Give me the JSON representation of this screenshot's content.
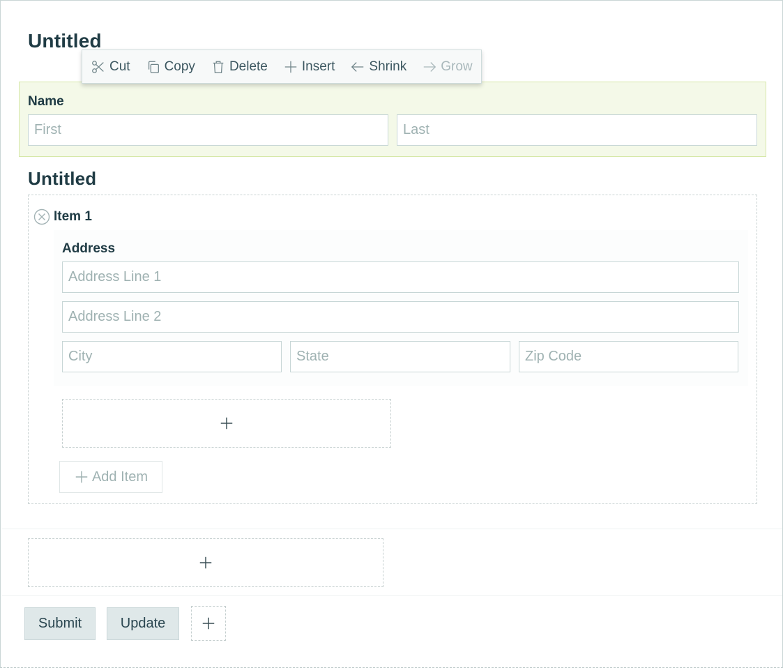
{
  "section1": {
    "title": "Untitled"
  },
  "toolbar": {
    "cut": {
      "label": "Cut",
      "icon": "scissors-icon"
    },
    "copy": {
      "label": "Copy",
      "icon": "copy-icon"
    },
    "delete": {
      "label": "Delete",
      "icon": "trash-icon"
    },
    "insert": {
      "label": "Insert",
      "icon": "plus-icon"
    },
    "shrink": {
      "label": "Shrink",
      "icon": "arrow-left-icon"
    },
    "grow": {
      "label": "Grow",
      "icon": "arrow-right-icon",
      "disabled": true
    }
  },
  "name_field": {
    "label": "Name",
    "first_placeholder": "First",
    "last_placeholder": "Last",
    "highlight_color": "#f4f9e8"
  },
  "section2": {
    "title": "Untitled",
    "item_title": "Item 1",
    "address": {
      "label": "Address",
      "line1_placeholder": "Address Line 1",
      "line2_placeholder": "Address Line 2",
      "city_placeholder": "City",
      "state_placeholder": "State",
      "zip_placeholder": "Zip Code"
    },
    "add_item_label": "Add Item"
  },
  "footer": {
    "submit_label": "Submit",
    "update_label": "Update"
  }
}
